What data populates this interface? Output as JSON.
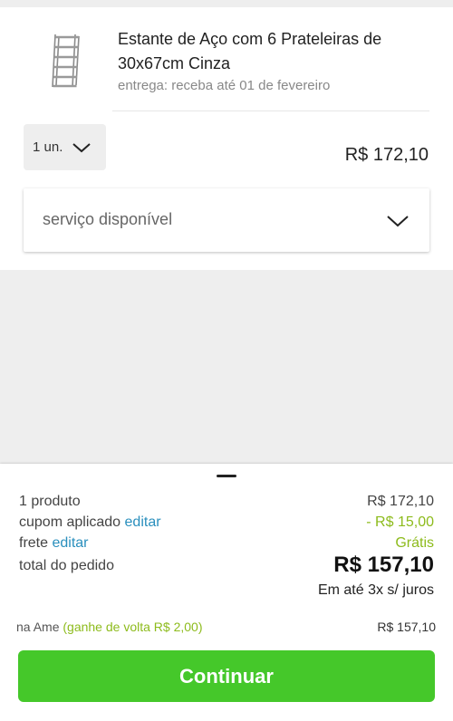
{
  "product": {
    "title": "Estante de Aço com 6 Prateleiras de 30x67cm Cinza",
    "delivery": "entrega: receba até 01 de fevereiro",
    "thumbnail_icon": "steel-shelf-image",
    "quantity": "1 un.",
    "price": "R$ 172,10",
    "service_placeholder": "serviço disponível"
  },
  "summary": {
    "products_label": "1 produto",
    "products_value": "R$ 172,10",
    "coupon_label": "cupom aplicado",
    "coupon_link": "editar",
    "coupon_value": "- R$ 15,00",
    "shipping_label": "frete",
    "shipping_link": "editar",
    "shipping_value": "Grátis",
    "total_label": "total do pedido",
    "total_value": "R$ 157,10",
    "installments": "Em até 3x s/ juros",
    "ame_label": "na Ame",
    "ame_cashback": "(ganhe de volta R$ 2,00)",
    "ame_value": "R$ 157,10",
    "continue_button": "Continuar"
  },
  "colors": {
    "accent_green": "#45c82a",
    "discount_green": "#8dbb1c",
    "link_blue": "#2a8fbd"
  }
}
